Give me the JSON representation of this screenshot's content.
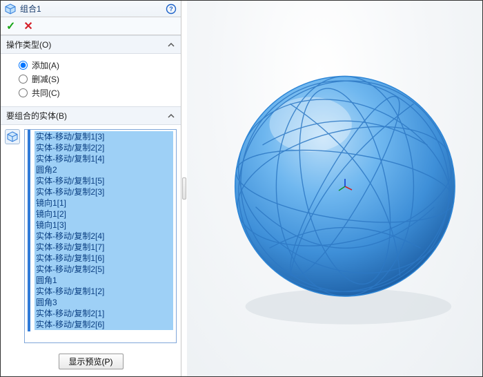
{
  "titlebar": {
    "title": "组合1",
    "help_symbol": "?"
  },
  "actions": {
    "ok_symbol": "✓",
    "cancel_symbol": "✕"
  },
  "operation": {
    "header": "操作类型(O)",
    "options": [
      {
        "label": "添加(A)",
        "checked": true
      },
      {
        "label": "删减(S)",
        "checked": false
      },
      {
        "label": "共同(C)",
        "checked": false
      }
    ]
  },
  "bodies": {
    "header": "要组合的实体(B)",
    "items": [
      "实体-移动/复制1[3]",
      "实体-移动/复制2[2]",
      "实体-移动/复制1[4]",
      "圆角2",
      "实体-移动/复制1[5]",
      "实体-移动/复制2[3]",
      "镜向1[1]",
      "镜向1[2]",
      "镜向1[3]",
      "实体-移动/复制2[4]",
      "实体-移动/复制1[7]",
      "实体-移动/复制1[6]",
      "实体-移动/复制2[5]",
      "圆角1",
      "实体-移动/复制1[2]",
      "圆角3",
      "实体-移动/复制2[1]",
      "实体-移动/复制2[6]"
    ]
  },
  "footer": {
    "preview_label": "显示预览(P)"
  },
  "colors": {
    "sphere_light": "#6fb7ef",
    "sphere_mid": "#3e8fd8",
    "sphere_dark": "#1d5fa5",
    "wire": "#2d78c4"
  }
}
